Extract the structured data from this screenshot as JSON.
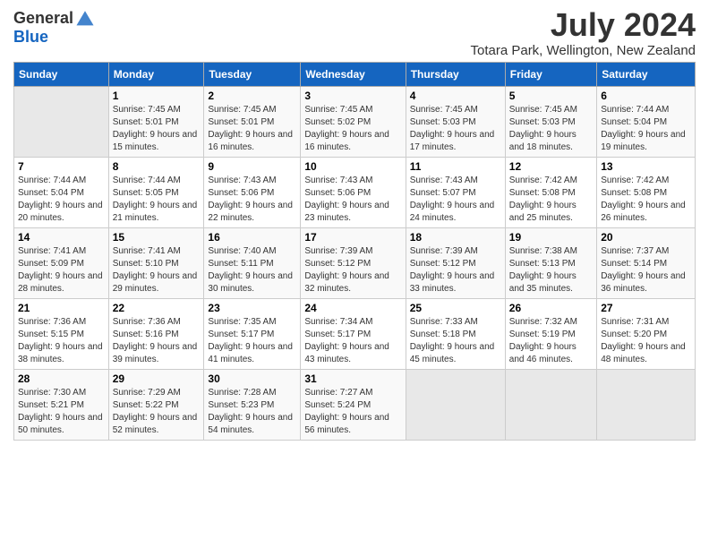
{
  "header": {
    "logo_general": "General",
    "logo_blue": "Blue",
    "title": "July 2024",
    "subtitle": "Totara Park, Wellington, New Zealand"
  },
  "days_of_week": [
    "Sunday",
    "Monday",
    "Tuesday",
    "Wednesday",
    "Thursday",
    "Friday",
    "Saturday"
  ],
  "weeks": [
    [
      {
        "day": "",
        "empty": true
      },
      {
        "day": "1",
        "sunrise": "7:45 AM",
        "sunset": "5:01 PM",
        "daylight": "9 hours and 15 minutes."
      },
      {
        "day": "2",
        "sunrise": "7:45 AM",
        "sunset": "5:01 PM",
        "daylight": "9 hours and 16 minutes."
      },
      {
        "day": "3",
        "sunrise": "7:45 AM",
        "sunset": "5:02 PM",
        "daylight": "9 hours and 16 minutes."
      },
      {
        "day": "4",
        "sunrise": "7:45 AM",
        "sunset": "5:03 PM",
        "daylight": "9 hours and 17 minutes."
      },
      {
        "day": "5",
        "sunrise": "7:45 AM",
        "sunset": "5:03 PM",
        "daylight": "9 hours and 18 minutes."
      },
      {
        "day": "6",
        "sunrise": "7:44 AM",
        "sunset": "5:04 PM",
        "daylight": "9 hours and 19 minutes."
      }
    ],
    [
      {
        "day": "7",
        "sunrise": "7:44 AM",
        "sunset": "5:04 PM",
        "daylight": "9 hours and 20 minutes."
      },
      {
        "day": "8",
        "sunrise": "7:44 AM",
        "sunset": "5:05 PM",
        "daylight": "9 hours and 21 minutes."
      },
      {
        "day": "9",
        "sunrise": "7:43 AM",
        "sunset": "5:06 PM",
        "daylight": "9 hours and 22 minutes."
      },
      {
        "day": "10",
        "sunrise": "7:43 AM",
        "sunset": "5:06 PM",
        "daylight": "9 hours and 23 minutes."
      },
      {
        "day": "11",
        "sunrise": "7:43 AM",
        "sunset": "5:07 PM",
        "daylight": "9 hours and 24 minutes."
      },
      {
        "day": "12",
        "sunrise": "7:42 AM",
        "sunset": "5:08 PM",
        "daylight": "9 hours and 25 minutes."
      },
      {
        "day": "13",
        "sunrise": "7:42 AM",
        "sunset": "5:08 PM",
        "daylight": "9 hours and 26 minutes."
      }
    ],
    [
      {
        "day": "14",
        "sunrise": "7:41 AM",
        "sunset": "5:09 PM",
        "daylight": "9 hours and 28 minutes."
      },
      {
        "day": "15",
        "sunrise": "7:41 AM",
        "sunset": "5:10 PM",
        "daylight": "9 hours and 29 minutes."
      },
      {
        "day": "16",
        "sunrise": "7:40 AM",
        "sunset": "5:11 PM",
        "daylight": "9 hours and 30 minutes."
      },
      {
        "day": "17",
        "sunrise": "7:39 AM",
        "sunset": "5:12 PM",
        "daylight": "9 hours and 32 minutes."
      },
      {
        "day": "18",
        "sunrise": "7:39 AM",
        "sunset": "5:12 PM",
        "daylight": "9 hours and 33 minutes."
      },
      {
        "day": "19",
        "sunrise": "7:38 AM",
        "sunset": "5:13 PM",
        "daylight": "9 hours and 35 minutes."
      },
      {
        "day": "20",
        "sunrise": "7:37 AM",
        "sunset": "5:14 PM",
        "daylight": "9 hours and 36 minutes."
      }
    ],
    [
      {
        "day": "21",
        "sunrise": "7:36 AM",
        "sunset": "5:15 PM",
        "daylight": "9 hours and 38 minutes."
      },
      {
        "day": "22",
        "sunrise": "7:36 AM",
        "sunset": "5:16 PM",
        "daylight": "9 hours and 39 minutes."
      },
      {
        "day": "23",
        "sunrise": "7:35 AM",
        "sunset": "5:17 PM",
        "daylight": "9 hours and 41 minutes."
      },
      {
        "day": "24",
        "sunrise": "7:34 AM",
        "sunset": "5:17 PM",
        "daylight": "9 hours and 43 minutes."
      },
      {
        "day": "25",
        "sunrise": "7:33 AM",
        "sunset": "5:18 PM",
        "daylight": "9 hours and 45 minutes."
      },
      {
        "day": "26",
        "sunrise": "7:32 AM",
        "sunset": "5:19 PM",
        "daylight": "9 hours and 46 minutes."
      },
      {
        "day": "27",
        "sunrise": "7:31 AM",
        "sunset": "5:20 PM",
        "daylight": "9 hours and 48 minutes."
      }
    ],
    [
      {
        "day": "28",
        "sunrise": "7:30 AM",
        "sunset": "5:21 PM",
        "daylight": "9 hours and 50 minutes."
      },
      {
        "day": "29",
        "sunrise": "7:29 AM",
        "sunset": "5:22 PM",
        "daylight": "9 hours and 52 minutes."
      },
      {
        "day": "30",
        "sunrise": "7:28 AM",
        "sunset": "5:23 PM",
        "daylight": "9 hours and 54 minutes."
      },
      {
        "day": "31",
        "sunrise": "7:27 AM",
        "sunset": "5:24 PM",
        "daylight": "9 hours and 56 minutes."
      },
      {
        "day": "",
        "empty": true
      },
      {
        "day": "",
        "empty": true
      },
      {
        "day": "",
        "empty": true
      }
    ]
  ]
}
